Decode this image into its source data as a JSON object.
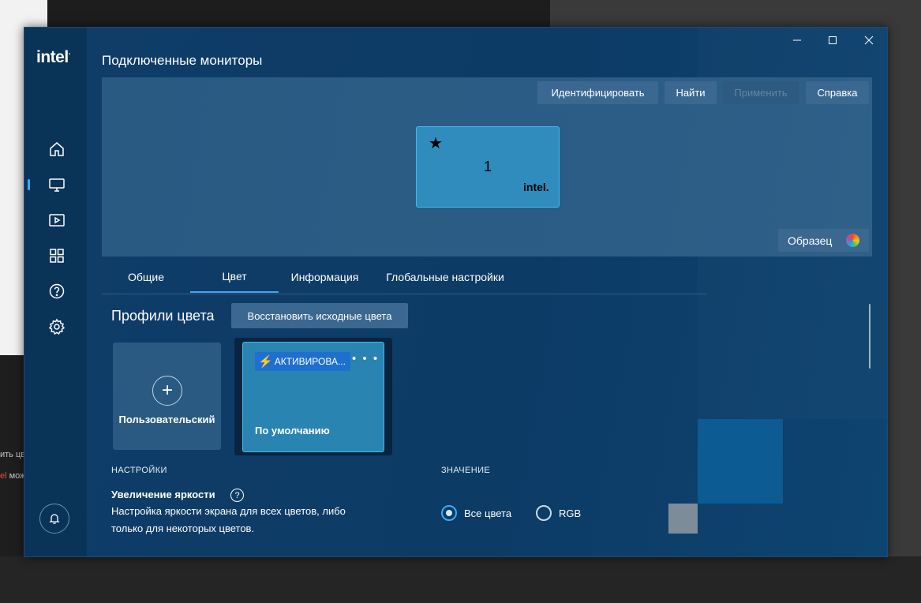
{
  "background": {
    "left_text_1": "ить цв",
    "left_text_2_accent": "el",
    "left_text_2": " мож"
  },
  "sidebar": {
    "logo": "intel",
    "nav": [
      {
        "name": "home",
        "icon": "home-icon"
      },
      {
        "name": "display",
        "icon": "monitor-icon",
        "active": true
      },
      {
        "name": "video",
        "icon": "video-icon"
      },
      {
        "name": "apps",
        "icon": "grid-icon"
      },
      {
        "name": "help",
        "icon": "help-icon"
      },
      {
        "name": "settings",
        "icon": "gear-icon"
      }
    ],
    "bell_icon": "bell-icon"
  },
  "titlebar": {
    "minimize": "—",
    "maximize": "☐",
    "close": "✕"
  },
  "page": {
    "title": "Подключенные мониторы"
  },
  "monitors": {
    "toolbar": {
      "identify": "Идентифицировать",
      "find": "Найти",
      "apply": "Применить",
      "help": "Справка"
    },
    "monitor": {
      "star": "★",
      "number": "1",
      "brand": "intel."
    },
    "sample_button": "Образец"
  },
  "tabs": [
    {
      "label": "Общие"
    },
    {
      "label": "Цвет",
      "active": true
    },
    {
      "label": "Информация"
    },
    {
      "label": "Глобальные настройки"
    }
  ],
  "color_profiles": {
    "title": "Профили цвета",
    "restore_button": "Восстановить исходные цвета",
    "custom_card": {
      "plus": "+",
      "label": "Пользовательский"
    },
    "default_card": {
      "badge": "АКТИВИРОВА...",
      "menu": "• • •",
      "label": "По умолчанию"
    }
  },
  "settings": {
    "col_settings": "НАСТРОЙКИ",
    "col_value": "ЗНАЧЕНИЕ",
    "brightness": {
      "title": "Увеличение яркости",
      "help": "?",
      "desc_line1": "Настройка яркости экрана для всех цветов, либо",
      "desc_line2": "только для некоторых цветов.",
      "options": [
        {
          "label": "Все цвета",
          "selected": true
        },
        {
          "label": "RGB",
          "selected": false
        }
      ]
    }
  },
  "colors": {
    "accent": "#3fa9f5",
    "window_bg": "#0e3a64",
    "badge": "#1f6fd1"
  }
}
